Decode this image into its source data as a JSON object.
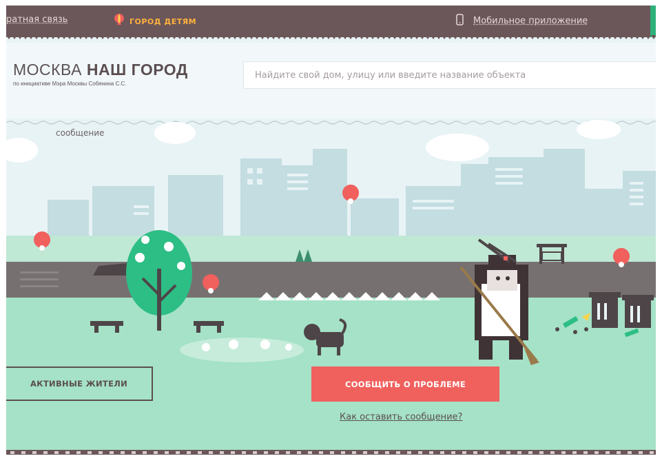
{
  "topbar": {
    "feedback_label": "ратная связь",
    "kids_label": "ГОРОД ДЕТЯМ",
    "mobile_label": "Мобильное приложение"
  },
  "header": {
    "logo_line1_a": "МОСКВА ",
    "logo_line1_b": "НАШ ГОРОД",
    "logo_line2": "по инициативе Мэра Москвы Собянина С.С."
  },
  "search": {
    "placeholder": "Найдите свой дом, улицу или введите название объекта"
  },
  "scene": {
    "message_label": "сообщение"
  },
  "actions": {
    "residents_label": "АКТИВНЫЕ ЖИТЕЛИ",
    "report_label": "СООБЩИТЬ О ПРОБЛЕМЕ",
    "how_label": "Как оставить сообщение?"
  },
  "colors": {
    "topbar": "#6b5659",
    "accent_red": "#f0605d",
    "grass": "#a5e2c7",
    "tree": "#2dbe85"
  }
}
